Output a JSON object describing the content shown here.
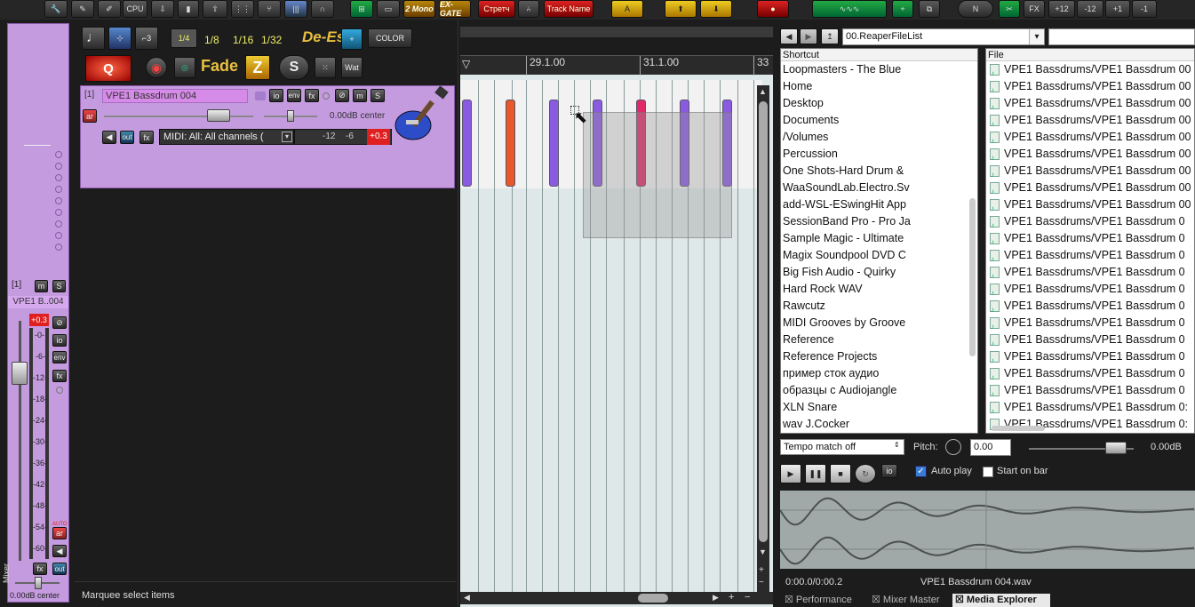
{
  "toolbar": {
    "cpu_label": "CPU",
    "two_mono_label": "2 Mono",
    "ex_gate_label": "EX-GATE",
    "stretch_label": "Стретч",
    "track_name_label": "Track Name",
    "plus12": "+12",
    "minus12": "-12",
    "plus1": "+1",
    "minus1": "-1",
    "fx_label": "FX"
  },
  "grid": {
    "q_quarter": "1/4",
    "q_eighth": "1/8",
    "q_sixteenth": "1/16",
    "q_32nd": "1/32",
    "deesser": "De-Esse",
    "color": "COLOR",
    "fade": "Fade",
    "wat": "Wat"
  },
  "track": {
    "number": "[1]",
    "name": "VPE1 Bassdrum 004",
    "io": "io",
    "env": "env",
    "fx": "fx",
    "m": "m",
    "s": "S",
    "ar": "ar",
    "volume_pan": "0.00dB center",
    "out": "out",
    "midi_input": "MIDI: All: All channels (",
    "meter_m12": "-12",
    "meter_m6": "-6",
    "peak": "+0.3"
  },
  "mixer": {
    "number": "[1]",
    "m": "m",
    "s": "S",
    "track_name": "VPE1 B..004",
    "peak": "+0.3",
    "scale": [
      "-0-",
      "-6-",
      "-12-",
      "-18-",
      "-24-",
      "-30-",
      "-36-",
      "-42-",
      "-48-",
      "-54-",
      "-60-"
    ],
    "io": "io",
    "env": "env",
    "fx": "fx",
    "auto": "AUTO",
    "ar": "ar",
    "out": "out",
    "volume": "0.00dB center",
    "side_label": "Mixer"
  },
  "status": {
    "text": "Marquee select items"
  },
  "ruler": {
    "mark1": "29.1.00",
    "mark2": "31.1.00",
    "mark3": "33"
  },
  "explorer": {
    "path": "00.ReaperFileList",
    "shortcut_header": "Shortcut",
    "file_header": "File",
    "shortcuts": [
      "Loopmasters - The Blue",
      "Home",
      "Desktop",
      "Documents",
      "/Volumes",
      "Percussion",
      "One Shots-Hard Drum &",
      "WaaSoundLab.Electro.Sv",
      "add-WSL-ESwingHit App",
      "SessionBand Pro - Pro Ja",
      "Sample Magic - Ultimate",
      "Magix Soundpool DVD C",
      "Big Fish Audio - Quirky",
      "Hard Rock WAV",
      "Rawcutz",
      "MIDI Grooves by Groove",
      "Reference",
      "Reference Projects",
      "пример сток аудио",
      "образцы с Audiojangle",
      "XLN Snare",
      "wav J.Cocker"
    ],
    "files": [
      "VPE1 Bassdrums/VPE1 Bassdrum 00",
      "VPE1 Bassdrums/VPE1 Bassdrum 00",
      "VPE1 Bassdrums/VPE1 Bassdrum 00",
      "VPE1 Bassdrums/VPE1 Bassdrum 00",
      "VPE1 Bassdrums/VPE1 Bassdrum 00",
      "VPE1 Bassdrums/VPE1 Bassdrum 00",
      "VPE1 Bassdrums/VPE1 Bassdrum 00",
      "VPE1 Bassdrums/VPE1 Bassdrum 00",
      "VPE1 Bassdrums/VPE1 Bassdrum 00",
      "VPE1 Bassdrums/VPE1 Bassdrum 0",
      "VPE1 Bassdrums/VPE1 Bassdrum 0",
      "VPE1 Bassdrums/VPE1 Bassdrum 0",
      "VPE1 Bassdrums/VPE1 Bassdrum 0",
      "VPE1 Bassdrums/VPE1 Bassdrum 0",
      "VPE1 Bassdrums/VPE1 Bassdrum 0",
      "VPE1 Bassdrums/VPE1 Bassdrum 0",
      "VPE1 Bassdrums/VPE1 Bassdrum 0",
      "VPE1 Bassdrums/VPE1 Bassdrum 0",
      "VPE1 Bassdrums/VPE1 Bassdrum 0",
      "VPE1 Bassdrums/VPE1 Bassdrum 0",
      "VPE1 Bassdrums/VPE1 Bassdrum 0:",
      "VPE1 Bassdrums/VPE1 Bassdrum 0:"
    ],
    "tempo": "Tempo match off",
    "pitch_label": "Pitch:",
    "pitch_value": "0.00",
    "volume": "0.00dB",
    "io": "io",
    "auto_play": "Auto play",
    "start_on_bar": "Start on bar",
    "position": "0:00.0/0:00.2",
    "filename": "VPE1 Bassdrum 004.wav"
  },
  "tabs": {
    "performance": "Performance",
    "mixer_master": "Mixer Master",
    "media_explorer": "Media Explorer"
  },
  "colors": {
    "track_purple": "#c59be0",
    "item_purple": "#8a5ae0",
    "item_orange": "#e8562a",
    "item_pink": "#e02a6a",
    "peak_red": "#e02020"
  }
}
